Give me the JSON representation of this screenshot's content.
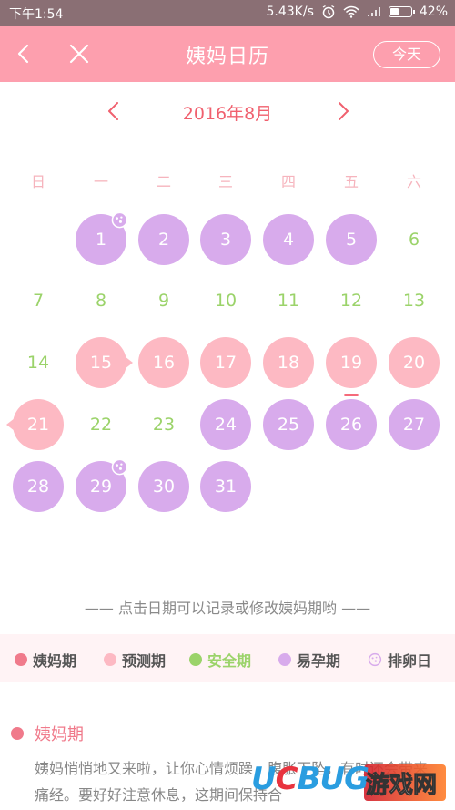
{
  "status_bar": {
    "time": "下午1:54",
    "speed": "5.43K/s",
    "battery": "42%",
    "battery_level": 0.42
  },
  "app_bar": {
    "title": "姨妈日历",
    "today_label": "今天"
  },
  "calendar": {
    "month_label": "2016年8月",
    "weekdays": [
      "日",
      "一",
      "二",
      "三",
      "四",
      "五",
      "六"
    ],
    "days": [
      {
        "day": "1",
        "type": "purple",
        "ovulation": true
      },
      {
        "day": "2",
        "type": "purple"
      },
      {
        "day": "3",
        "type": "purple"
      },
      {
        "day": "4",
        "type": "purple"
      },
      {
        "day": "5",
        "type": "purple"
      },
      {
        "day": "6",
        "type": "safe"
      },
      {
        "day": "7",
        "type": "safe"
      },
      {
        "day": "8",
        "type": "safe"
      },
      {
        "day": "9",
        "type": "safe"
      },
      {
        "day": "10",
        "type": "safe"
      },
      {
        "day": "11",
        "type": "safe"
      },
      {
        "day": "12",
        "type": "safe"
      },
      {
        "day": "13",
        "type": "safe"
      },
      {
        "day": "14",
        "type": "safe"
      },
      {
        "day": "15",
        "type": "pink",
        "tail": "right"
      },
      {
        "day": "16",
        "type": "pink"
      },
      {
        "day": "17",
        "type": "pink"
      },
      {
        "day": "18",
        "type": "pink"
      },
      {
        "day": "19",
        "type": "pink",
        "today": true
      },
      {
        "day": "20",
        "type": "pink"
      },
      {
        "day": "21",
        "type": "pink",
        "tail": "left"
      },
      {
        "day": "22",
        "type": "safe"
      },
      {
        "day": "23",
        "type": "safe"
      },
      {
        "day": "24",
        "type": "purple"
      },
      {
        "day": "25",
        "type": "purple"
      },
      {
        "day": "26",
        "type": "purple"
      },
      {
        "day": "27",
        "type": "purple"
      },
      {
        "day": "28",
        "type": "purple"
      },
      {
        "day": "29",
        "type": "purple",
        "ovulation": true
      },
      {
        "day": "30",
        "type": "purple"
      },
      {
        "day": "31",
        "type": "purple"
      }
    ]
  },
  "hint": "—— 点击日期可以记录或修改姨妈期哟 ——",
  "legend": [
    {
      "label": "姨妈期",
      "color": "#f07a8b",
      "kind": "dot"
    },
    {
      "label": "预测期",
      "color": "#fdb9c3",
      "kind": "dot"
    },
    {
      "label": "安全期",
      "color": "#9bd36a",
      "kind": "dot"
    },
    {
      "label": "易孕期",
      "color": "#d8abec",
      "kind": "dot"
    },
    {
      "label": "排卵日",
      "color": "#d8abec",
      "kind": "ovulation"
    }
  ],
  "section": {
    "title": "姨妈期",
    "description": "姨妈悄悄地又来啦，让你心情烦躁，腹胀下坠，有时还会带来痛经。要好好注意休息，这期间保持合"
  },
  "watermark": {
    "brand": "UCBUG",
    "site": "游戏网"
  }
}
